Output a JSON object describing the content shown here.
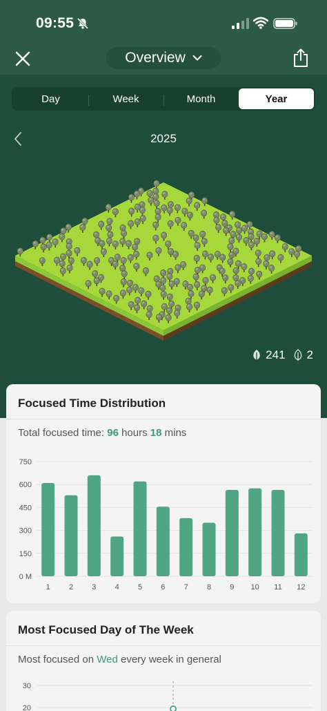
{
  "status": {
    "time": "09:55"
  },
  "nav": {
    "title": "Overview"
  },
  "tabs": [
    {
      "label": "Day",
      "active": false
    },
    {
      "label": "Week",
      "active": false
    },
    {
      "label": "Month",
      "active": false
    },
    {
      "label": "Year",
      "active": true
    }
  ],
  "year": "2025",
  "counts": {
    "healthy_trees": "241",
    "withered_trees": "2"
  },
  "colors": {
    "header_green": "#2c5a47",
    "dark_green": "#1f4d3b",
    "accent": "#3f9a78",
    "bar": "#4fa584",
    "grass": "#a6d83c"
  },
  "focused_time_card": {
    "title": "Focused Time Distribution",
    "total_prefix": "Total focused time: ",
    "hours": "96",
    "hours_label": " hours ",
    "mins": "18",
    "mins_label": " mins"
  },
  "chart_data": {
    "type": "bar",
    "categories": [
      "1",
      "2",
      "3",
      "4",
      "5",
      "6",
      "7",
      "8",
      "9",
      "10",
      "11",
      "12"
    ],
    "values": [
      610,
      530,
      660,
      260,
      620,
      455,
      380,
      350,
      565,
      575,
      565,
      280
    ],
    "ylim": [
      0,
      750
    ],
    "yticks": [
      "0 M",
      "150",
      "300",
      "450",
      "600",
      "750"
    ],
    "ytick_values": [
      0,
      150,
      300,
      450,
      600,
      750
    ],
    "grid": true
  },
  "most_focused_card": {
    "title": "Most Focused Day of The Week",
    "sub_prefix": "Most focused on ",
    "day": "Wed",
    "sub_suffix": " every week in general",
    "yticks": [
      "30",
      "20"
    ]
  }
}
